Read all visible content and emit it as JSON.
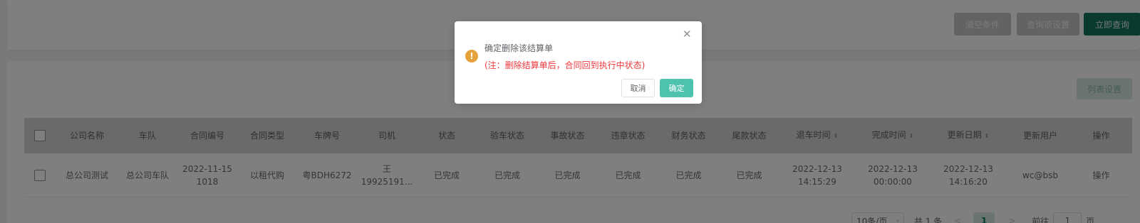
{
  "filter": {
    "clear_label": "清空条件",
    "settings_label": "查询项设置",
    "query_label": "立即查询"
  },
  "list": {
    "column_settings_label": "列表设置"
  },
  "table": {
    "headers": [
      "公司名称",
      "车队",
      "合同编号",
      "合同类型",
      "车牌号",
      "司机",
      "状态",
      "验车状态",
      "事故状态",
      "违章状态",
      "财务状态",
      "尾款状态",
      "退车时间",
      "完成时间",
      "更新日期",
      "更新用户",
      "操作"
    ],
    "sortable": [
      false,
      false,
      false,
      false,
      false,
      false,
      false,
      false,
      false,
      false,
      false,
      false,
      true,
      true,
      true,
      false,
      false
    ],
    "rows": [
      {
        "company": "总公司测试",
        "fleet": "总公司车队",
        "contract_no": [
          "2022-11-15",
          "1018"
        ],
        "contract_type": "以租代购",
        "plate": "粤BDH6272",
        "driver": [
          "王",
          "19925191..."
        ],
        "status": "已完成",
        "inspection": "已完成",
        "accident": "已完成",
        "violation": "已完成",
        "finance": "已完成",
        "balance": "已完成",
        "return_time": [
          "2022-12-13",
          "14:15:29"
        ],
        "complete_time": [
          "2022-12-13",
          "00:00:00"
        ],
        "update_date": [
          "2022-12-13",
          "14:16:20"
        ],
        "update_user": "wc@bsb",
        "action": "操作"
      }
    ]
  },
  "pager": {
    "page_size": "10条/页",
    "total": "共 1 条",
    "prev": "<",
    "current": "1",
    "next": ">",
    "goto_label": "前往",
    "goto_value": "1",
    "page_suffix": "页"
  },
  "dialog": {
    "title": "确定删除该结算单",
    "note": "(注：删除结算单后，合同回到执行中状态)",
    "cancel_label": "取消",
    "ok_label": "确定",
    "icon": "warning-icon"
  },
  "colors": {
    "primary": "#10755f",
    "warning": "#e6a23c",
    "danger": "#f0373c",
    "confirm": "#4dc2ad"
  }
}
